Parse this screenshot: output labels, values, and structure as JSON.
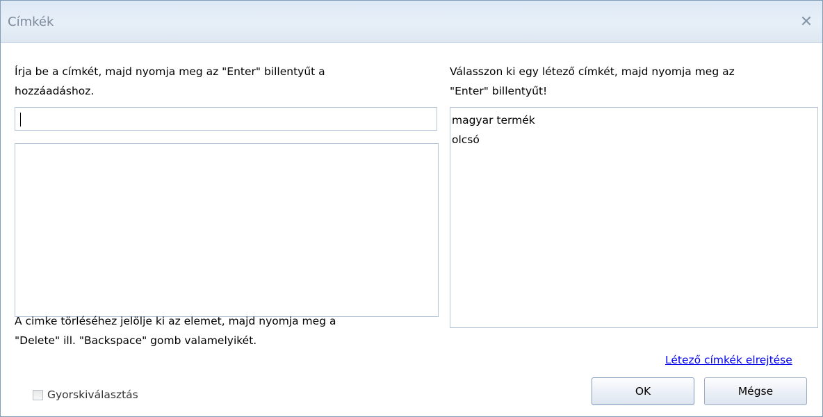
{
  "dialog": {
    "title": "Címkék",
    "close_glyph": "✕"
  },
  "left": {
    "instruction_line1": "Írja be a címkét, majd nyomja meg az \"Enter\" billentyűt a",
    "instruction_line2": "hozzáadáshoz.",
    "input_value": "",
    "tags": [],
    "delete_hint_line1": "A cimke törléséhez jelölje ki az elemet, majd nyomja meg a",
    "delete_hint_line2": "\"Delete\" ill. \"Backspace\" gomb valamelyikét."
  },
  "right": {
    "instruction_line1": "Válasszon ki egy létező címkét, majd nyomja meg az",
    "instruction_line2": "\"Enter\" billentyűt!",
    "existing_tags": [
      "magyar termék",
      "olcsó"
    ],
    "hide_link": "Létező címkék elrejtése"
  },
  "footer": {
    "quick_select_label": "Gyorskiválasztás",
    "quick_select_checked": false,
    "ok_label": "OK",
    "cancel_label": "Mégse"
  },
  "colors": {
    "title_text": "#7c8a9a",
    "border": "#b4c4d9",
    "link": "#0000ee"
  },
  "icons": {
    "close": "close-icon"
  }
}
